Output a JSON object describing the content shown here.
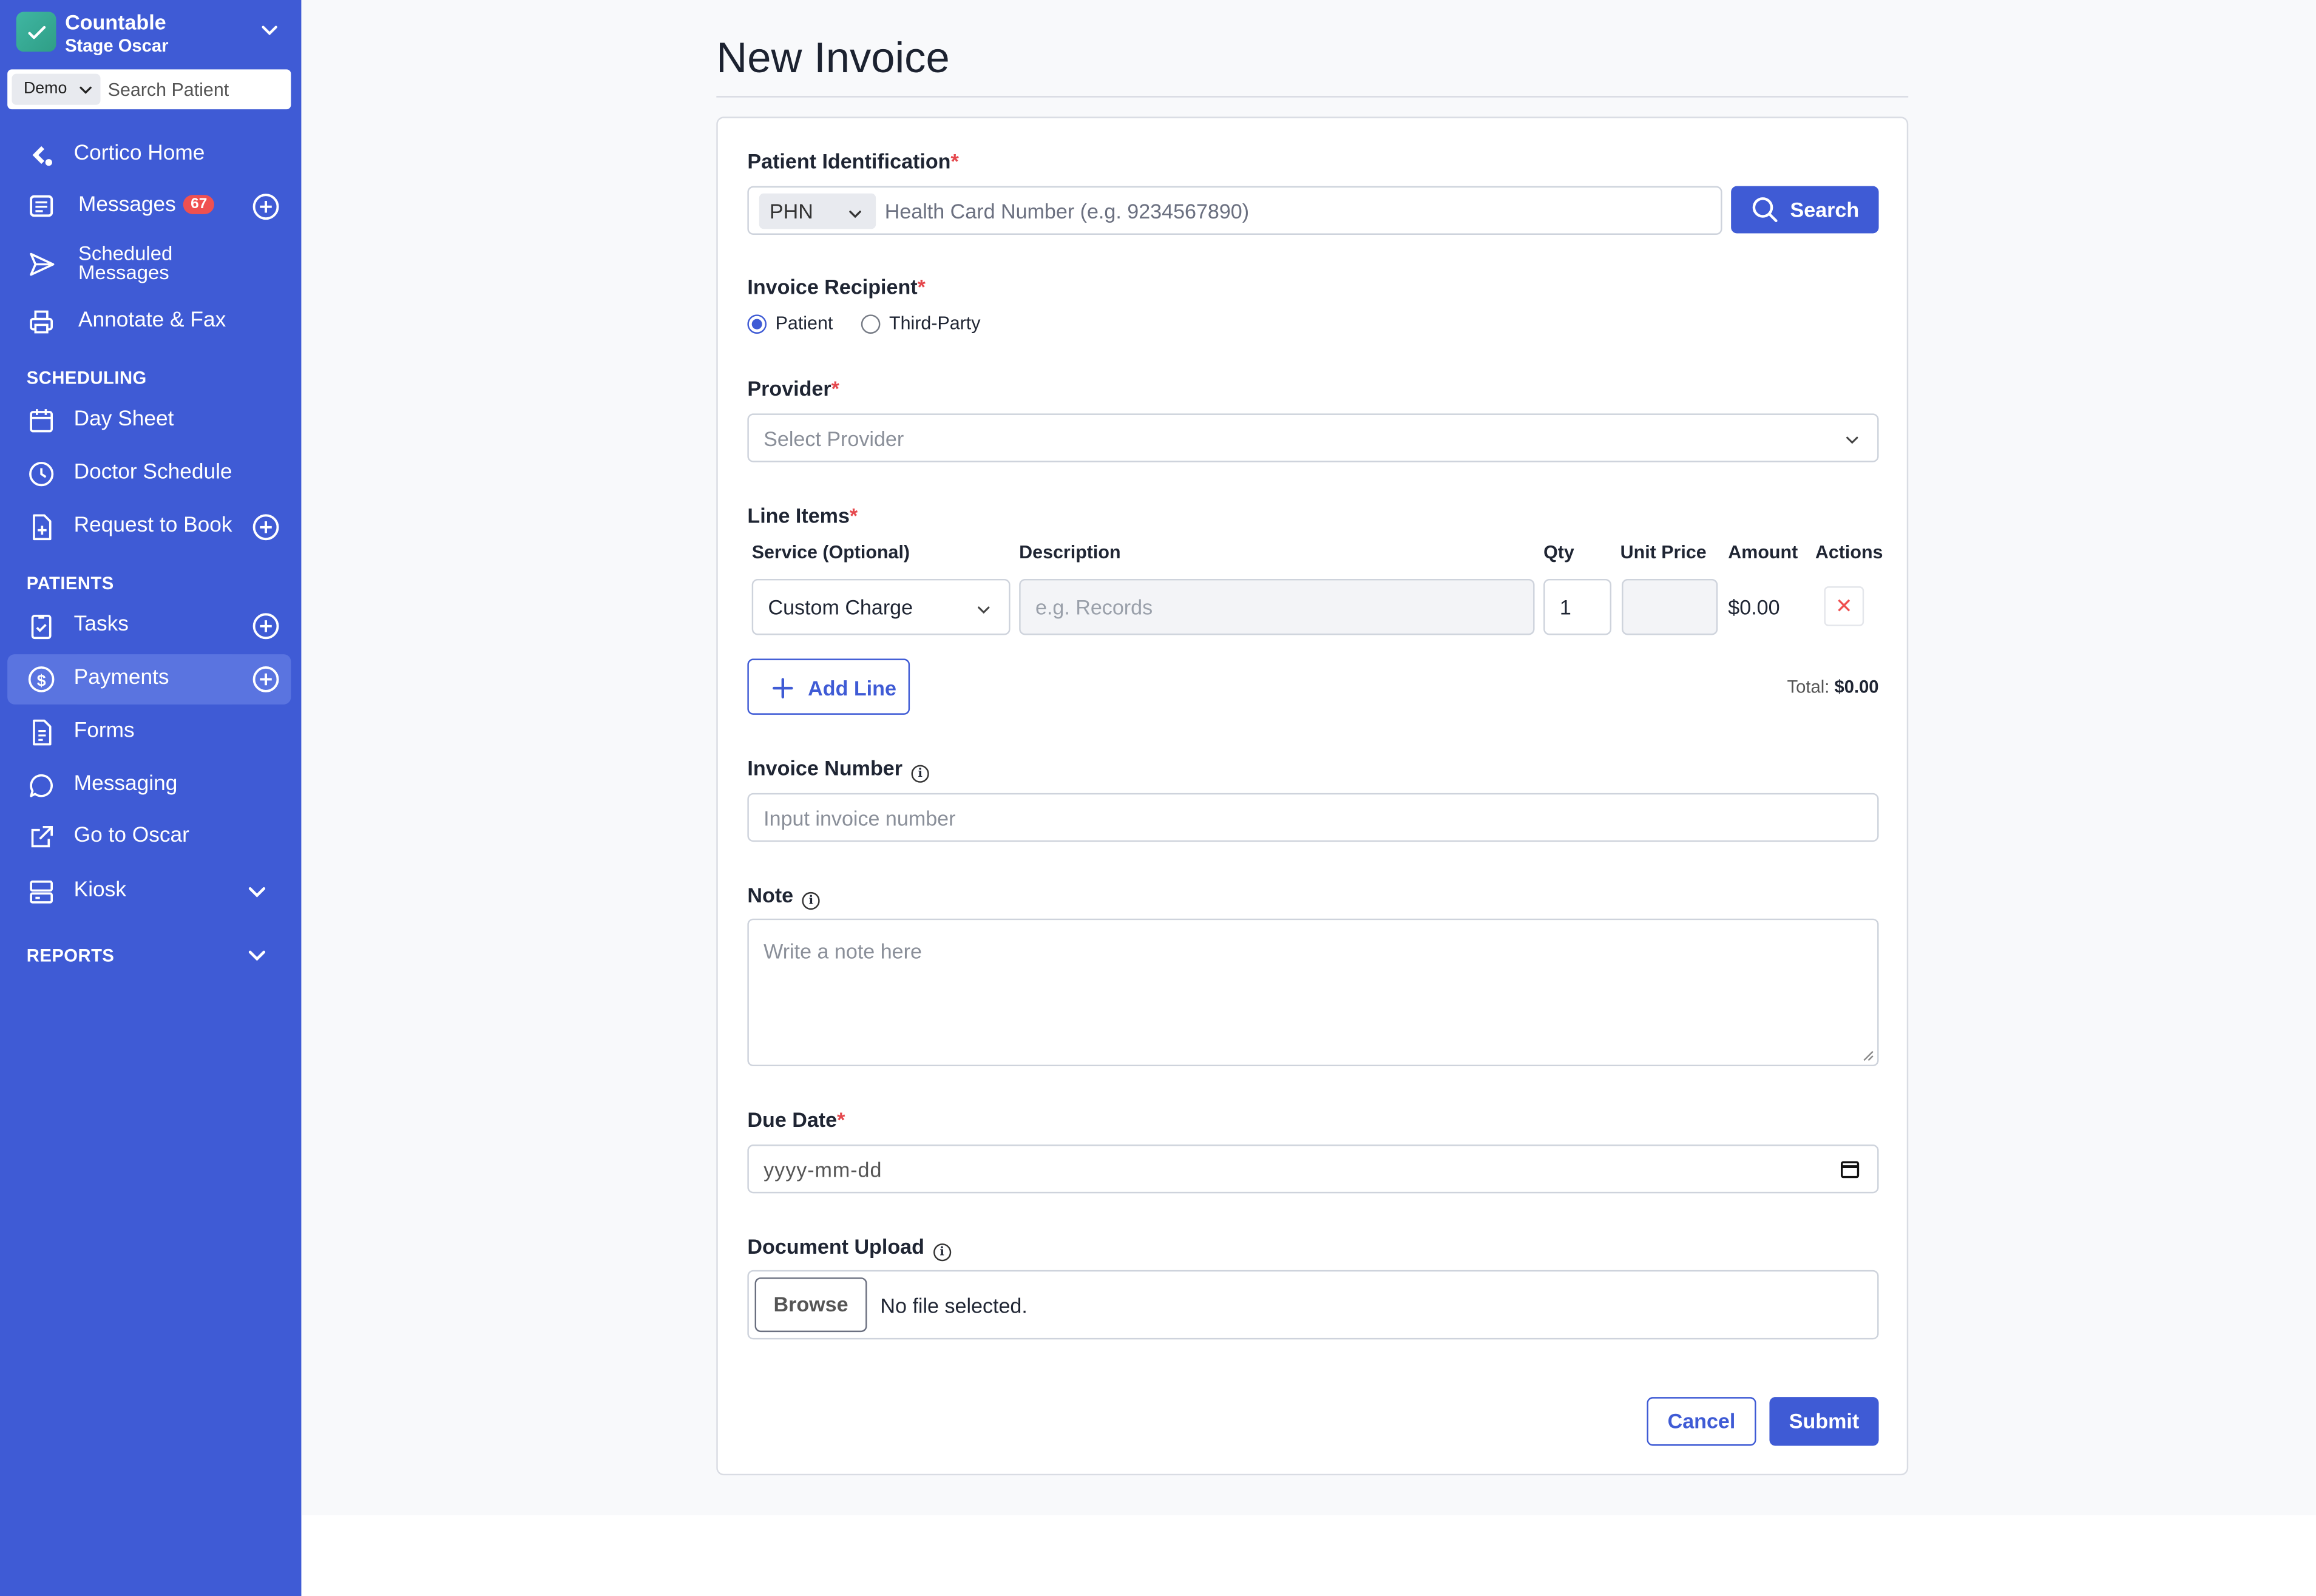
{
  "colors": {
    "sidebar": "#3f5bd5",
    "accent": "#3f5bd5",
    "badge": "#ef5050",
    "required": "#e5484d"
  },
  "org": {
    "name": "Countable",
    "subtitle": "Stage Oscar"
  },
  "search": {
    "scope": "Demo",
    "placeholder": "Search Patient"
  },
  "nav": {
    "cortico_home": "Cortico Home",
    "messages": "Messages",
    "messages_badge": "67",
    "scheduled_messages": "Scheduled Messages",
    "annotate_fax": "Annotate & Fax",
    "scheduling_header": "SCHEDULING",
    "day_sheet": "Day Sheet",
    "doctor_schedule": "Doctor Schedule",
    "request_to_book": "Request to Book",
    "patients_header": "PATIENTS",
    "tasks": "Tasks",
    "payments": "Payments",
    "forms": "Forms",
    "messaging": "Messaging",
    "go_to_oscar": "Go to Oscar",
    "kiosk": "Kiosk",
    "reports_header": "REPORTS"
  },
  "page": {
    "title": "New Invoice"
  },
  "form": {
    "patient_id_label": "Patient Identification",
    "id_type": "PHN",
    "id_placeholder": "Health Card Number (e.g. 9234567890)",
    "search_button": "Search",
    "recipient_label": "Invoice Recipient",
    "recipient_options": [
      "Patient",
      "Third-Party"
    ],
    "recipient_selected": "Patient",
    "provider_label": "Provider",
    "provider_placeholder": "Select Provider",
    "line_items_label": "Line Items",
    "columns": [
      "Service (Optional)",
      "Description",
      "Qty",
      "Unit Price",
      "Amount",
      "Actions"
    ],
    "line_items": [
      {
        "service": "Custom Charge",
        "description_placeholder": "e.g. Records",
        "qty": "1",
        "unit_price": "",
        "amount": "$0.00"
      }
    ],
    "delete_icon": "✕",
    "add_line_button": "Add Line",
    "total_label": "Total:",
    "total_value": "$0.00",
    "invoice_number_label": "Invoice Number",
    "invoice_number_placeholder": "Input invoice number",
    "note_label": "Note",
    "note_placeholder": "Write a note here",
    "due_date_label": "Due Date",
    "due_date_placeholder": "yyyy-mm-dd",
    "document_upload_label": "Document Upload",
    "browse_button": "Browse",
    "no_file_text": "No file selected.",
    "cancel_button": "Cancel",
    "submit_button": "Submit",
    "required_marker": "*",
    "info_glyph": "i"
  }
}
